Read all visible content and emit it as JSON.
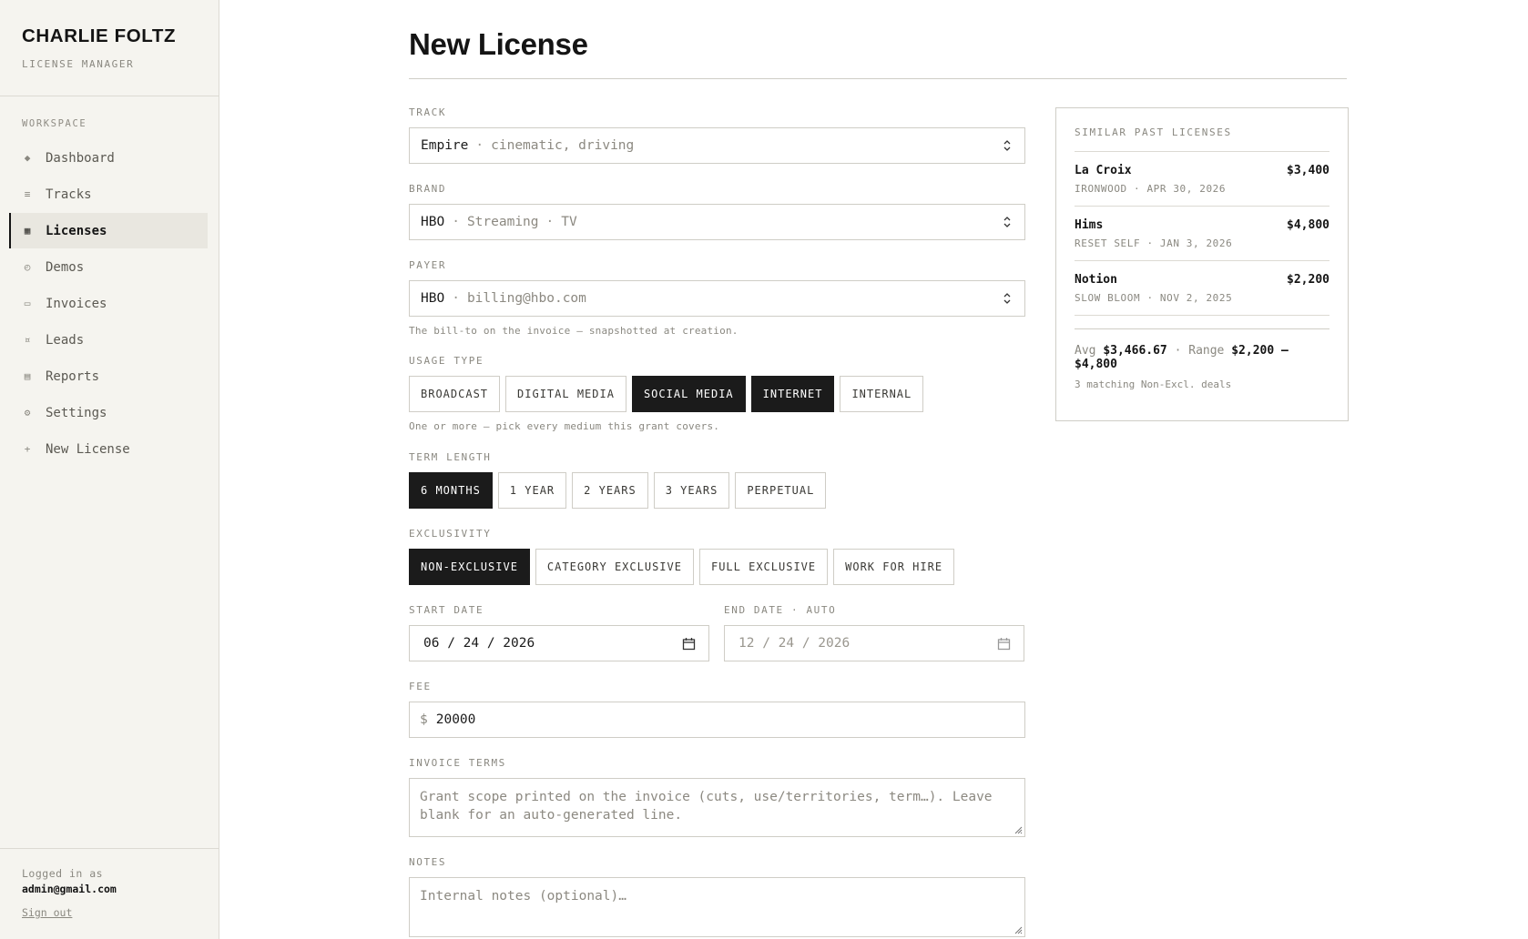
{
  "sidebar": {
    "brand": "CHARLIE FOLTZ",
    "subtitle": "LICENSE MANAGER",
    "section_heading": "WORKSPACE",
    "items": [
      {
        "label": "Dashboard",
        "icon": "diamond-icon",
        "glyph": "◆"
      },
      {
        "label": "Tracks",
        "icon": "tracks-icon",
        "glyph": "≡"
      },
      {
        "label": "Licenses",
        "icon": "licenses-icon",
        "glyph": "▦",
        "active": true
      },
      {
        "label": "Demos",
        "icon": "demos-icon",
        "glyph": "◴"
      },
      {
        "label": "Invoices",
        "icon": "invoice-icon",
        "glyph": "▭"
      },
      {
        "label": "Leads",
        "icon": "leads-icon",
        "glyph": "¤"
      },
      {
        "label": "Reports",
        "icon": "reports-icon",
        "glyph": "▤"
      },
      {
        "label": "Settings",
        "icon": "gear-icon",
        "glyph": "⚙"
      },
      {
        "label": "New License",
        "icon": "plus-icon",
        "glyph": "+"
      }
    ],
    "logged_in_label": "Logged in as",
    "logged_in_email": "admin@gmail.com",
    "sign_out": "Sign out"
  },
  "page": {
    "title": "New License"
  },
  "form": {
    "track": {
      "label": "TRACK",
      "value": "Empire",
      "detail": "cinematic, driving"
    },
    "brand": {
      "label": "BRAND",
      "value": "HBO",
      "detail1": "Streaming",
      "detail2": "TV"
    },
    "payer": {
      "label": "PAYER",
      "value": "HBO",
      "detail": "billing@hbo.com",
      "hint": "The bill-to on the invoice — snapshotted at creation."
    },
    "usage_type": {
      "label": "USAGE TYPE",
      "options": [
        "BROADCAST",
        "DIGITAL MEDIA",
        "SOCIAL MEDIA",
        "INTERNET",
        "INTERNAL"
      ],
      "selected": [
        "SOCIAL MEDIA",
        "INTERNET"
      ],
      "hint": "One or more — pick every medium this grant covers."
    },
    "term_length": {
      "label": "TERM LENGTH",
      "options": [
        "6 MONTHS",
        "1 YEAR",
        "2 YEARS",
        "3 YEARS",
        "PERPETUAL"
      ],
      "selected": "6 MONTHS"
    },
    "exclusivity": {
      "label": "EXCLUSIVITY",
      "options": [
        "NON-EXCLUSIVE",
        "CATEGORY EXCLUSIVE",
        "FULL EXCLUSIVE",
        "WORK FOR HIRE"
      ],
      "selected": "NON-EXCLUSIVE"
    },
    "start_date": {
      "label": "START DATE",
      "value": "06 / 24 / 2026"
    },
    "end_date": {
      "label": "END DATE · AUTO",
      "value": "12 / 24 / 2026"
    },
    "fee": {
      "label": "FEE",
      "currency": "$",
      "value": "20000"
    },
    "invoice_terms": {
      "label": "INVOICE TERMS",
      "placeholder": "Grant scope printed on the invoice (cuts, use/territories, term…). Leave blank for an auto-generated line."
    },
    "notes": {
      "label": "NOTES",
      "placeholder": "Internal notes (optional)…"
    }
  },
  "similar": {
    "title": "SIMILAR PAST LICENSES",
    "items": [
      {
        "brand": "La Croix",
        "amount": "$3,400",
        "meta": "IRONWOOD · APR 30, 2026"
      },
      {
        "brand": "Hims",
        "amount": "$4,800",
        "meta": "RESET SELF · JAN 3, 2026"
      },
      {
        "brand": "Notion",
        "amount": "$2,200",
        "meta": "SLOW BLOOM · NOV 2, 2025"
      }
    ],
    "avg_label": "Avg",
    "avg_value": "$3,466.67",
    "range_label": "Range",
    "range_value": "$2,200 – $4,800",
    "matching": "3 matching Non-Excl. deals"
  },
  "colors": {
    "sidebar_bg": "#f5f4ef",
    "selected_chip": "#1b1b1b",
    "border": "#cfcdc6",
    "muted_text": "#8a8880"
  }
}
